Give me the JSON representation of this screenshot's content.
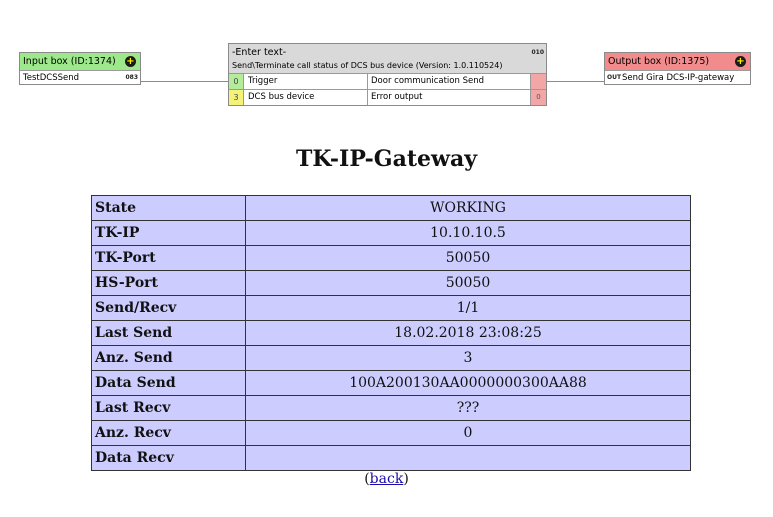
{
  "logic": {
    "input_box": {
      "title": "Input box (ID:1374)",
      "value": "TestDCSSend",
      "tag": "083"
    },
    "block": {
      "title": "-Enter text-",
      "tag": "010",
      "subtitle": "Send\\Terminate call status of DCS bus device (Version: 1.0.110524)",
      "inputs": [
        {
          "num": "0",
          "label": "Trigger"
        },
        {
          "num": "3",
          "label": "DCS bus device"
        }
      ],
      "outputs": [
        {
          "label": "Door communication Send",
          "num": ""
        },
        {
          "label": "Error output",
          "num": "0"
        }
      ]
    },
    "output_box": {
      "title": "Output box (ID:1375)",
      "tag": "OUT",
      "value": "Send Gira DCS-IP-gateway"
    }
  },
  "page": {
    "title": "TK-IP-Gateway",
    "rows": [
      {
        "key": "State",
        "value": "WORKING"
      },
      {
        "key": "TK-IP",
        "value": "10.10.10.5"
      },
      {
        "key": "TK-Port",
        "value": "50050"
      },
      {
        "key": "HS-Port",
        "value": "50050"
      },
      {
        "key": "Send/Recv",
        "value": "1/1"
      },
      {
        "key": "Last Send",
        "value": "18.02.2018 23:08:25"
      },
      {
        "key": "Anz. Send",
        "value": "3"
      },
      {
        "key": "Data Send",
        "value": "100A200130AA0000000300AA88"
      },
      {
        "key": "Last Recv",
        "value": "???"
      },
      {
        "key": "Anz. Recv",
        "value": "0"
      },
      {
        "key": "Data Recv",
        "value": ""
      }
    ],
    "back": {
      "open": "(",
      "label": "back",
      "close": ")"
    }
  },
  "colors": {
    "input_header": "#9ee88c",
    "output_header": "#f28b8b",
    "table_cell": "#ccccff",
    "link": "#1a0dab"
  },
  "icons": {
    "add": "plus-circle-icon"
  }
}
